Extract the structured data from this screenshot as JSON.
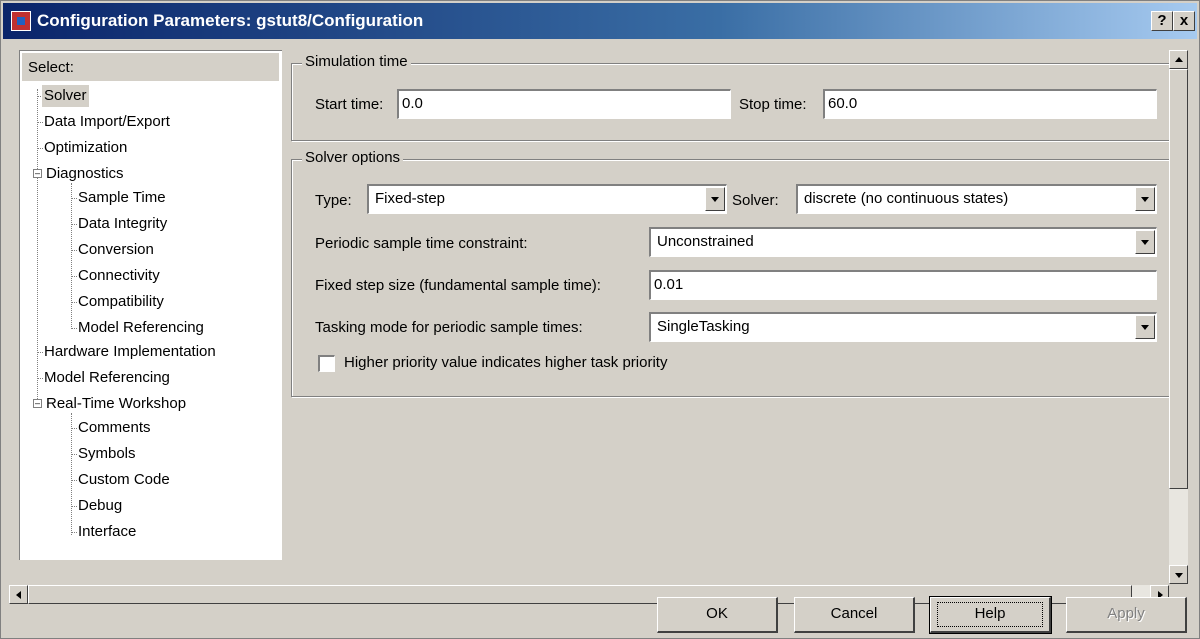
{
  "window": {
    "title": "Configuration Parameters: gstut8/Configuration",
    "help_button": "?",
    "close_button": "x"
  },
  "tree": {
    "header": "Select:",
    "items": [
      {
        "label": "Solver",
        "selected": true
      },
      {
        "label": "Data Import/Export"
      },
      {
        "label": "Optimization"
      },
      {
        "label": "Diagnostics",
        "expanded": true
      },
      {
        "label": "Sample Time"
      },
      {
        "label": "Data Integrity"
      },
      {
        "label": "Conversion"
      },
      {
        "label": "Connectivity"
      },
      {
        "label": "Compatibility"
      },
      {
        "label": "Model Referencing"
      },
      {
        "label": "Hardware Implementation"
      },
      {
        "label": "Model Referencing"
      },
      {
        "label": "Real-Time Workshop",
        "expanded": true
      },
      {
        "label": "Comments"
      },
      {
        "label": "Symbols"
      },
      {
        "label": "Custom Code"
      },
      {
        "label": "Debug"
      },
      {
        "label": "Interface"
      }
    ]
  },
  "simulation_time": {
    "title": "Simulation time",
    "start_label": "Start time:",
    "start_value": "0.0",
    "stop_label": "Stop time:",
    "stop_value": "60.0"
  },
  "solver_options": {
    "title": "Solver options",
    "type_label": "Type:",
    "type_value": "Fixed-step",
    "solver_label": "Solver:",
    "solver_value": "discrete (no continuous states)",
    "periodic_label": "Periodic sample time constraint:",
    "periodic_value": "Unconstrained",
    "stepsize_label": "Fixed step size (fundamental sample time):",
    "stepsize_value": "0.01",
    "tasking_label": "Tasking mode for periodic sample times:",
    "tasking_value": "SingleTasking",
    "priority_label": "Higher priority value indicates higher task priority",
    "priority_checked": false
  },
  "buttons": {
    "ok": "OK",
    "cancel": "Cancel",
    "help": "Help",
    "apply": "Apply"
  },
  "colors": {
    "face": "#d4d0c8",
    "titlebar_start": "#0a246a",
    "titlebar_end": "#a6caf0"
  }
}
